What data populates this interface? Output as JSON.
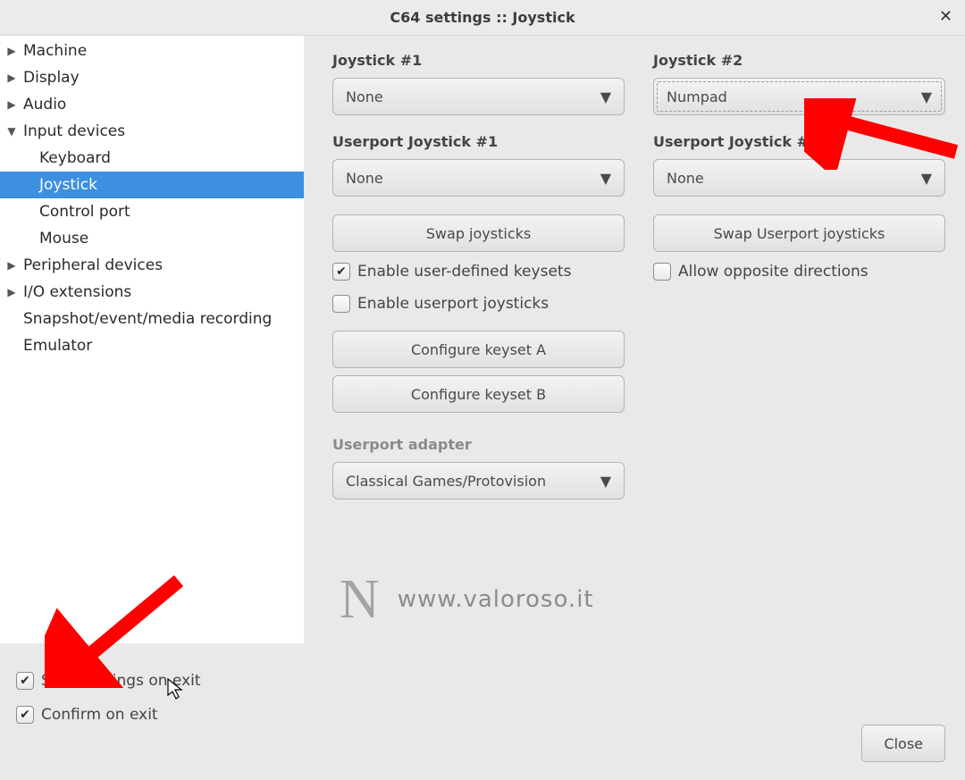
{
  "title": "C64 settings :: Joystick",
  "sidebar": {
    "items": [
      {
        "label": "Machine",
        "expandable": true,
        "expanded": false
      },
      {
        "label": "Display",
        "expandable": true,
        "expanded": false
      },
      {
        "label": "Audio",
        "expandable": true,
        "expanded": false
      },
      {
        "label": "Input devices",
        "expandable": true,
        "expanded": true,
        "children": [
          {
            "label": "Keyboard"
          },
          {
            "label": "Joystick",
            "selected": true
          },
          {
            "label": "Control port"
          },
          {
            "label": "Mouse"
          }
        ]
      },
      {
        "label": "Peripheral devices",
        "expandable": true,
        "expanded": false
      },
      {
        "label": "I/O extensions",
        "expandable": true,
        "expanded": false
      },
      {
        "label": "Snapshot/event/media recording",
        "expandable": false
      },
      {
        "label": "Emulator",
        "expandable": false
      }
    ]
  },
  "panel": {
    "joystick1": {
      "title": "Joystick #1",
      "value": "None"
    },
    "joystick2": {
      "title": "Joystick #2",
      "value": "Numpad"
    },
    "userport1": {
      "title": "Userport Joystick #1",
      "value": "None"
    },
    "userport2": {
      "title": "Userport Joystick #2",
      "value": "None"
    },
    "swap_joysticks": "Swap joysticks",
    "swap_userport": "Swap Userport joysticks",
    "enable_keysets": {
      "label": "Enable user-defined keysets",
      "checked": true
    },
    "enable_userport_joy": {
      "label": "Enable userport joysticks",
      "checked": false
    },
    "allow_opposite": {
      "label": "Allow opposite directions",
      "checked": false
    },
    "configure_a": "Configure keyset A",
    "configure_b": "Configure keyset B",
    "userport_adapter": {
      "title": "Userport adapter",
      "value": "Classical Games/Protovision"
    }
  },
  "footer": {
    "save_on_exit": {
      "label": "Save settings on exit",
      "checked": true
    },
    "confirm_on_exit": {
      "label": "Confirm on exit",
      "checked": true
    },
    "close": "Close"
  },
  "watermark": {
    "mark": "N",
    "url": "www.valoroso.it"
  }
}
